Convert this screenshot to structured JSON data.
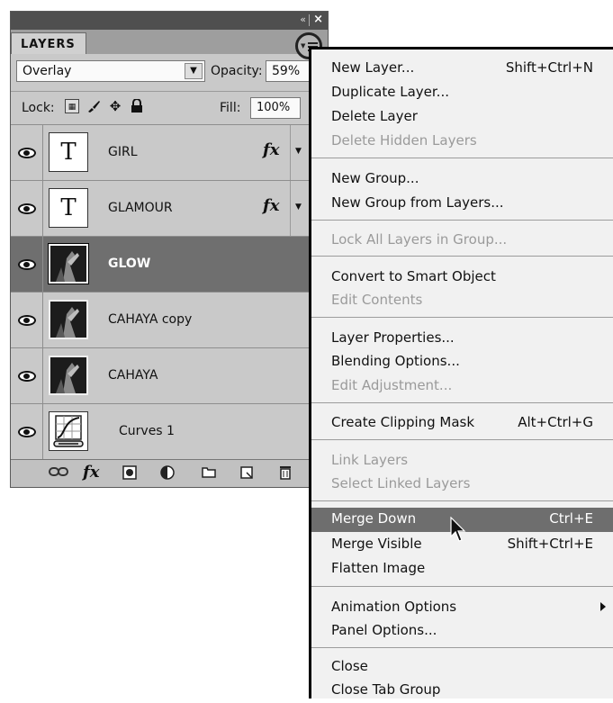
{
  "panel": {
    "tab_label": "LAYERS",
    "collapse_icon": "«",
    "close_icon": "×",
    "blend_mode": "Overlay",
    "opacity_label": "Opacity:",
    "opacity_value": "59%",
    "lock_label": "Lock:",
    "fill_label": "Fill:",
    "fill_value": "100%",
    "layers": [
      {
        "name": "GIRL",
        "kind": "text",
        "thumb_glyph": "T",
        "fx": "fx",
        "visible": true,
        "selected": false
      },
      {
        "name": "GLAMOUR",
        "kind": "text",
        "thumb_glyph": "T",
        "fx": "fx",
        "visible": true,
        "selected": false
      },
      {
        "name": "GLOW",
        "kind": "photo",
        "visible": true,
        "selected": true
      },
      {
        "name": "CAHAYA copy",
        "kind": "photo",
        "visible": true,
        "selected": false
      },
      {
        "name": "CAHAYA",
        "kind": "photo",
        "visible": true,
        "selected": false
      },
      {
        "name": "Curves 1",
        "kind": "adjustment",
        "visible": true,
        "selected": false
      }
    ],
    "bottom_icons": [
      "link-icon",
      "fx-icon",
      "mask-icon",
      "adjustment-icon",
      "group-folder-icon",
      "new-layer-icon",
      "trash-icon"
    ],
    "fx_glyph": "fx"
  },
  "menu": {
    "items": [
      {
        "label": "New Layer...",
        "shortcut": "Shift+Ctrl+N"
      },
      {
        "label": "Duplicate Layer..."
      },
      {
        "label": "Delete Layer"
      },
      {
        "label": "Delete Hidden Layers",
        "disabled": true
      },
      {
        "label": "New Group..."
      },
      {
        "label": "New Group from Layers..."
      },
      {
        "label": "Lock All Layers in Group...",
        "disabled": true
      },
      {
        "label": "Convert to Smart Object"
      },
      {
        "label": "Edit Contents",
        "disabled": true
      },
      {
        "label": "Layer Properties..."
      },
      {
        "label": "Blending Options..."
      },
      {
        "label": "Edit Adjustment...",
        "disabled": true
      },
      {
        "label": "Create Clipping Mask",
        "shortcut": "Alt+Ctrl+G"
      },
      {
        "label": "Link Layers",
        "disabled": true
      },
      {
        "label": "Select Linked Layers",
        "disabled": true
      },
      {
        "label": "Merge Down",
        "shortcut": "Ctrl+E",
        "highlighted": true
      },
      {
        "label": "Merge Visible",
        "shortcut": "Shift+Ctrl+E"
      },
      {
        "label": "Flatten Image"
      },
      {
        "label": "Animation Options",
        "submenu": true
      },
      {
        "label": "Panel Options..."
      },
      {
        "label": "Close"
      },
      {
        "label": "Close Tab Group"
      }
    ]
  },
  "colors": {
    "selection": "#6f6f6f",
    "menu_highlight": "#6e6e6e",
    "disabled_text": "#9a9a9a"
  }
}
